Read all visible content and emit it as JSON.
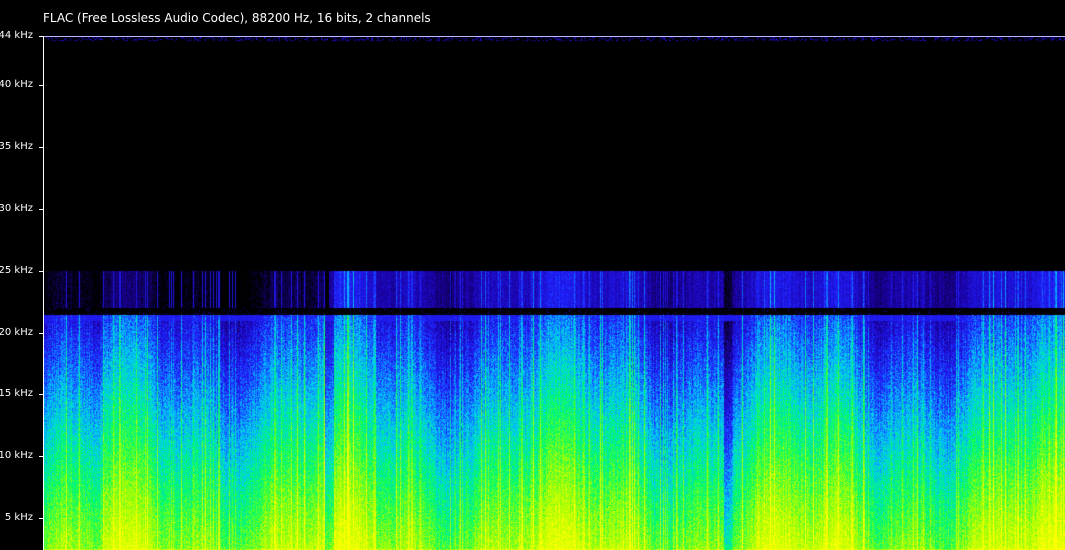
{
  "header": {
    "format_info": "FLAC (Free Lossless Audio Codec), 88200 Hz, 16 bits, 2 channels"
  },
  "chart_data": {
    "type": "heatmap",
    "kind": "spectrogram",
    "title": "",
    "xlabel": "",
    "ylabel": "",
    "ylim": [
      0,
      44
    ],
    "y_unit": "kHz",
    "y_ticks": [
      {
        "value": 5,
        "label": "5 kHz"
      },
      {
        "value": 10,
        "label": "10 kHz"
      },
      {
        "value": 15,
        "label": "15 kHz"
      },
      {
        "value": 20,
        "label": "20 kHz"
      },
      {
        "value": 25,
        "label": "25 kHz"
      },
      {
        "value": 30,
        "label": "30 kHz"
      },
      {
        "value": 35,
        "label": "35 kHz"
      },
      {
        "value": 40,
        "label": "40 kHz"
      },
      {
        "value": 44,
        "label": "44 kHz"
      }
    ],
    "colormap": [
      "#000000",
      "#1a00a0",
      "#2020ff",
      "#00c8ff",
      "#00ff60",
      "#a8ff00",
      "#ffff00"
    ],
    "band_limit_khz": 21.5,
    "artifact_band_khz": [
      22,
      25
    ],
    "track_boundaries_fraction": [
      0.28,
      0.67
    ],
    "grid": false,
    "legend": "none"
  }
}
